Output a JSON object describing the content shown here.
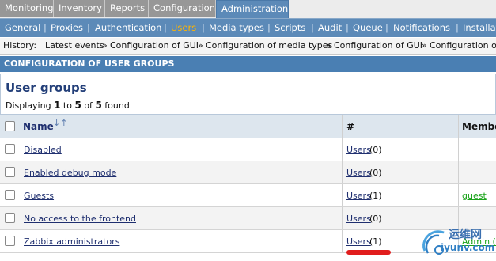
{
  "tabs": [
    {
      "label": "Monitoring"
    },
    {
      "label": "Inventory"
    },
    {
      "label": "Reports"
    },
    {
      "label": "Configuration"
    },
    {
      "label": "Administration"
    }
  ],
  "subnav": [
    {
      "label": "General"
    },
    {
      "label": "Proxies"
    },
    {
      "label": "Authentication"
    },
    {
      "label": "Users"
    },
    {
      "label": "Media types"
    },
    {
      "label": "Scripts"
    },
    {
      "label": "Audit"
    },
    {
      "label": "Queue"
    },
    {
      "label": "Notifications"
    },
    {
      "label": "Installat"
    }
  ],
  "history": {
    "label": "History:",
    "items": [
      "Latest events",
      "Configuration of GUI",
      "Configuration of media types",
      "Configuration of GUI",
      "Configuration of"
    ],
    "sep": "»"
  },
  "section_title": "CONFIGURATION OF USER GROUPS",
  "page_title": "User groups",
  "displaying": {
    "prefix": "Displaying",
    "from": "1",
    "to_word": "to",
    "to": "5",
    "of_word": "of",
    "total": "5",
    "suffix": "found"
  },
  "table": {
    "columns": [
      "Name",
      "#",
      "Membe"
    ],
    "rows": [
      {
        "name": "Disabled",
        "users_link": "Users",
        "count": "(0)",
        "members": ""
      },
      {
        "name": "Enabled debug mode",
        "users_link": "Users",
        "count": "(0)",
        "members": ""
      },
      {
        "name": "Guests",
        "users_link": "Users",
        "count": "(1)",
        "members": "guest"
      },
      {
        "name": "No access to the frontend",
        "users_link": "Users",
        "count": "(0)",
        "members": ""
      },
      {
        "name": "Zabbix administrators",
        "users_link": "Users",
        "count": "(1)",
        "members": "Admin (Z"
      }
    ]
  },
  "watermark": {
    "line1": "运维网",
    "line2": "iyunv.com"
  },
  "colors": {
    "accent": "#5c8ab8",
    "active_subnav": "#ffb400",
    "link": "#1f2f6f",
    "annotation": "#e11d1d",
    "member": "#19a319"
  }
}
